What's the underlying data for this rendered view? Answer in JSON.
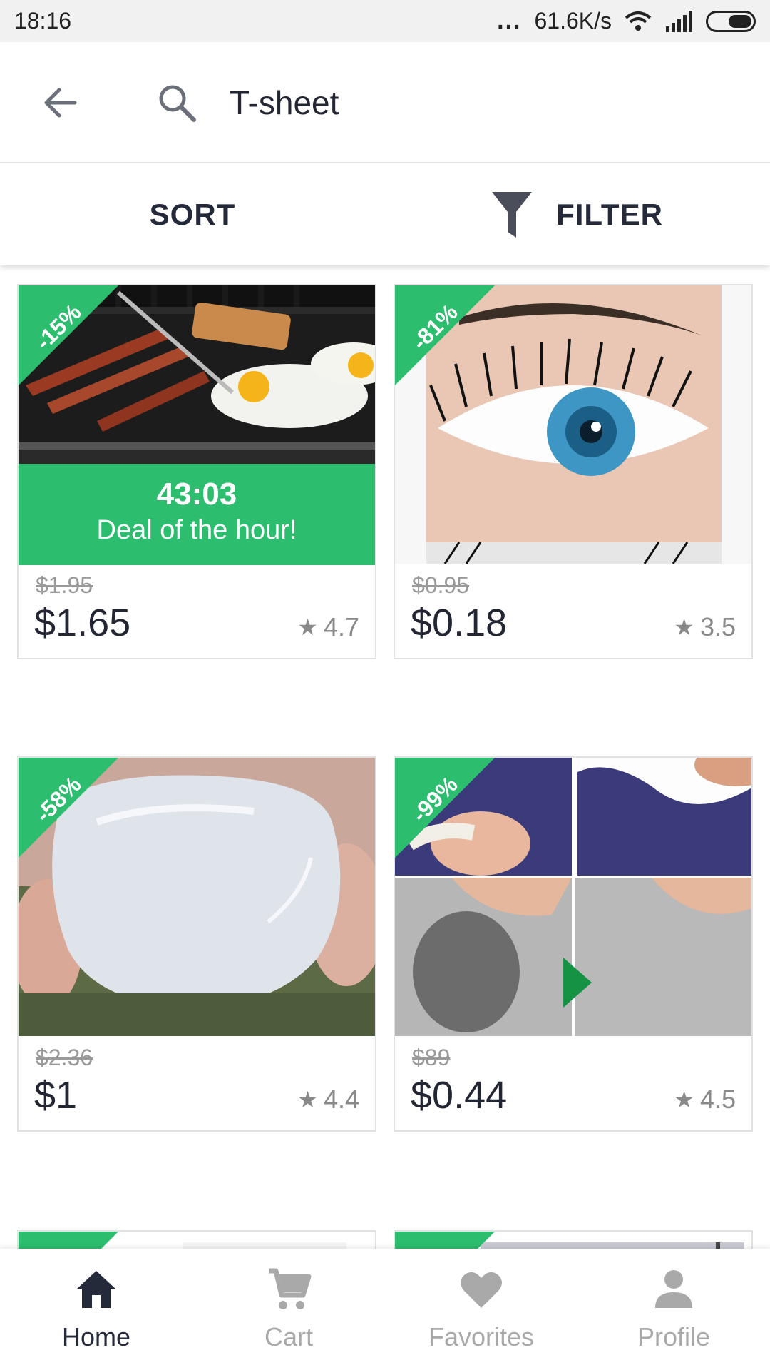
{
  "status_bar": {
    "time": "18:16",
    "dots": "...",
    "speed": "61.6K/s"
  },
  "search": {
    "query": "T-sheet"
  },
  "sort_filter": {
    "sort_label": "SORT",
    "filter_label": "FILTER"
  },
  "products": [
    {
      "discount": "-15%",
      "old_price": "$1.95",
      "price": "$1.65",
      "rating": "4.7",
      "deal_timer": "43:03",
      "deal_label": "Deal of the hour!"
    },
    {
      "discount": "-81%",
      "old_price": "$0.95",
      "price": "$0.18",
      "rating": "3.5"
    },
    {
      "discount": "-58%",
      "old_price": "$2.36",
      "price": "$1",
      "rating": "4.4"
    },
    {
      "discount": "-99%",
      "old_price": "$89",
      "price": "$0.44",
      "rating": "4.5"
    },
    {
      "discount": "%"
    },
    {
      "discount": "%"
    }
  ],
  "bottom_nav": {
    "items": [
      {
        "label": "Home",
        "icon": "home-icon",
        "active": true
      },
      {
        "label": "Cart",
        "icon": "cart-icon",
        "active": false
      },
      {
        "label": "Favorites",
        "icon": "heart-icon",
        "active": false
      },
      {
        "label": "Profile",
        "icon": "person-icon",
        "active": false
      }
    ]
  },
  "colors": {
    "accent": "#2dbd6e",
    "text": "#222633",
    "muted": "#9a9a9a"
  }
}
